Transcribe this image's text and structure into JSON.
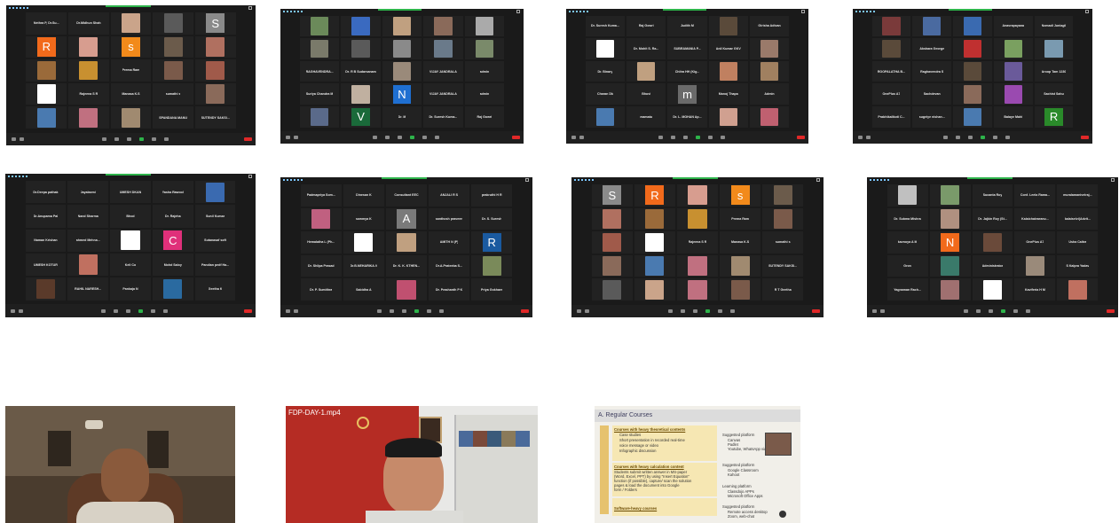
{
  "screens": [
    {
      "tiles": [
        {
          "name": "Nethra P, Dr.Su..."
        },
        {
          "name": "Dr.Midhun Shah"
        },
        {
          "photo": "#caa48a"
        },
        {
          "photo": "#5a5a5a"
        },
        {
          "letter": "S",
          "color": "#8a8a8a"
        },
        {
          "letter": "R",
          "color": "#f26a1b"
        },
        {
          "photo": "#d79d8f"
        },
        {
          "letter": "s",
          "color": "#f28a1b"
        },
        {
          "photo": "#6b5b4b"
        },
        {
          "photo": "#b07060"
        },
        {
          "photo": "#9a6a3a"
        },
        {
          "photo": "#c89030"
        },
        {
          "name": "Prema Ram"
        },
        {
          "photo": "#7a5a4a"
        },
        {
          "photo": "#a05a4a"
        },
        {
          "photo": "#ffffff"
        },
        {
          "name": "Rajeena S R"
        },
        {
          "name": "Manasa K.S"
        },
        {
          "name": "sumathi s"
        },
        {
          "photo": "#8a6a5a"
        },
        {
          "photo": "#4a7ab0"
        },
        {
          "photo": "#c07080"
        },
        {
          "photo": "#a08a70"
        },
        {
          "name": "SPANDANA MANU"
        },
        {
          "name": "SUTENDY SAKSI..."
        }
      ]
    },
    {
      "tiles": [
        {
          "photo": "#6b8a5a"
        },
        {
          "photo": "#3a6ac0"
        },
        {
          "photo": "#c0a080"
        },
        {
          "photo": "#8a6a5a"
        },
        {
          "photo": "#aaaaaa"
        },
        {
          "photo": "#7a7a6a"
        },
        {
          "photo": "#5a5a5a"
        },
        {
          "photo": "#8a8a8a"
        },
        {
          "photo": "#6a7a8a"
        },
        {
          "photo": "#7a8a6a"
        },
        {
          "name": "RAGHAVENDRA... "
        },
        {
          "name": "Dr. R B Sudarsanam"
        },
        {
          "photo": "#9a8a7a"
        },
        {
          "name": "VIJAY JANDRALA"
        },
        {
          "name": "admin"
        },
        {
          "name": "Suriya Chandra M"
        },
        {
          "photo": "#c0b0a0"
        },
        {
          "letter": "N",
          "color": "#1f6fd1"
        },
        {
          "name": "VIJAY JANDRALA"
        },
        {
          "name": "admin"
        },
        {
          "photo": "#5a6a8a"
        },
        {
          "letter": "V",
          "color": "#1a6a3a"
        },
        {
          "name": "Dr. M"
        },
        {
          "name": "Dr. Suresh Kuma..."
        },
        {
          "name": "Raj Gowri"
        }
      ]
    },
    {
      "tiles": [
        {
          "name": "Dr. Suresh Kuma..."
        },
        {
          "name": "Raj Gowri"
        },
        {
          "name": "Judith M"
        },
        {
          "photo": "#5a4a3a"
        },
        {
          "name": "Girisha Adivan"
        },
        {
          "photo": "#ffffff"
        },
        {
          "name": "Dr. Mohit S. Ra..."
        },
        {
          "name": "SUBRAMANIA P..."
        },
        {
          "name": "Anil Kumar GKV"
        },
        {
          "photo": "#9a7a6a"
        },
        {
          "name": "Dr. Binary"
        },
        {
          "photo": "#c0a080"
        },
        {
          "name": "Chitra HH (Kig..."
        },
        {
          "photo": "#c08060"
        },
        {
          "photo": "#a08060"
        },
        {
          "name": "Charan Dk"
        },
        {
          "name": "Bhuvi"
        },
        {
          "letter": "m",
          "color": "#6a6a6a"
        },
        {
          "name": "Manoj Thapa"
        },
        {
          "name": "Admin"
        },
        {
          "photo": "#4a7ab0"
        },
        {
          "name": "mamatu"
        },
        {
          "name": "Dr. L. MOHAN Ap..."
        },
        {
          "photo": "#d0a090"
        },
        {
          "photo": "#c06070"
        }
      ]
    },
    {
      "tiles": [
        {
          "photo": "#7a3a3a"
        },
        {
          "photo": "#4a6aa0"
        },
        {
          "photo": "#3a6ab0"
        },
        {
          "name": "Anavrapayana"
        },
        {
          "name": "Nomadi Juniagil"
        },
        {
          "photo": "#5a4a3a"
        },
        {
          "name": "Akshara George"
        },
        {
          "photo": "#c03030"
        },
        {
          "photo": "#7aa060"
        },
        {
          "photo": "#7a9ab0"
        },
        {
          "name": "ROOPALATHA B..."
        },
        {
          "name": "Raghavendra S"
        },
        {
          "photo": "#5a4a3a"
        },
        {
          "photo": "#6a5a9a"
        },
        {
          "name": "Aroop Tam 1230"
        },
        {
          "name": "OnePlus A7"
        },
        {
          "name": "Sachdevan"
        },
        {
          "photo": "#8a6a5a"
        },
        {
          "photo": "#9a4ab0"
        },
        {
          "name": "Sachist Sahu"
        },
        {
          "name": "Prabhikalikoti C..."
        },
        {
          "name": "sugeiye nishan..."
        },
        {
          "photo": "#4a7ab0"
        },
        {
          "name": "Balaye Mahi"
        },
        {
          "letter": "R",
          "color": "#2a8a2a"
        }
      ]
    },
    {
      "tiles": [
        {
          "name": "Dr.Deepa pathak"
        },
        {
          "name": "Jayalaxmi"
        },
        {
          "name": "UMESH DKAN"
        },
        {
          "name": "Yasha Rawool"
        },
        {
          "photo": "#3a6ab0"
        },
        {
          "name": "Dr.Anupama Pal"
        },
        {
          "name": "Nand Sharma"
        },
        {
          "name": "Bhod"
        },
        {
          "name": "Dr. Rajeha"
        },
        {
          "name": "Sunil Kumar"
        },
        {
          "name": "Naman Krishan"
        },
        {
          "name": "ahmed Mehna..."
        },
        {
          "photo": "#ffffff"
        },
        {
          "letter": "C",
          "color": "#e0307a"
        },
        {
          "name": "Sutanasaf soft"
        },
        {
          "name": "UMESH KOTUR"
        },
        {
          "photo": "#c07060"
        },
        {
          "name": "Keli Co"
        },
        {
          "name": "Mohd Saloy"
        },
        {
          "name": "Pandian pedf Ha..."
        },
        {
          "photo": "#5a3a2a"
        },
        {
          "name": "RAHIL NARESH..."
        },
        {
          "name": "Pankaja N"
        },
        {
          "photo": "#2a6aa0"
        },
        {
          "name": "Geetha K"
        }
      ]
    },
    {
      "tiles": [
        {
          "name": "Padmapriya Som..."
        },
        {
          "name": "Dinesan K"
        },
        {
          "name": "Consultant EEC"
        },
        {
          "name": "ANJALI R S"
        },
        {
          "name": "prakruthi H R"
        },
        {
          "photo": "#c06080"
        },
        {
          "name": "sowmya K"
        },
        {
          "letter": "A",
          "color": "#7a7a7a"
        },
        {
          "name": "santhosh praveen"
        },
        {
          "name": "Dr. S. Suresh"
        },
        {
          "name": "Hemalatha L (Ph..."
        },
        {
          "photo": "#ffffff"
        },
        {
          "photo": "#c0a080"
        },
        {
          "name": "AMITH N (P)"
        },
        {
          "letter": "R",
          "color": "#1a5aa0"
        },
        {
          "name": "Dr. Shilpa Prasad"
        },
        {
          "name": "Dr.B.NEHARIKA.V"
        },
        {
          "name": "Dr. K. K. KTHEN..."
        },
        {
          "name": "Dr.A.Prateeba S..."
        },
        {
          "photo": "#7a8a5a"
        },
        {
          "name": "Dr. P. Sumithra"
        },
        {
          "name": "Sabidha A"
        },
        {
          "photo": "#c05070"
        },
        {
          "name": "Dr. Prashanth P K"
        },
        {
          "name": "Priya Gokhare"
        }
      ]
    },
    {
      "tiles": [
        {
          "letter": "S",
          "color": "#8a8a8a"
        },
        {
          "letter": "R",
          "color": "#f26a1b"
        },
        {
          "photo": "#d79d8f"
        },
        {
          "letter": "s",
          "color": "#f28a1b"
        },
        {
          "photo": "#6b5b4b"
        },
        {
          "photo": "#b07060"
        },
        {
          "photo": "#9a6a3a"
        },
        {
          "photo": "#c89030"
        },
        {
          "name": "Prema Ram"
        },
        {
          "photo": "#7a5a4a"
        },
        {
          "photo": "#a05a4a"
        },
        {
          "photo": "#ffffff"
        },
        {
          "name": "Rajeena S R"
        },
        {
          "name": "Manasa K.S"
        },
        {
          "name": "sumathi s"
        },
        {
          "photo": "#8a6a5a"
        },
        {
          "photo": "#4a7ab0"
        },
        {
          "photo": "#c07080"
        },
        {
          "photo": "#a08a70"
        },
        {
          "name": "SUTENDY SAKSI..."
        },
        {
          "photo": "#5a5a5a"
        },
        {
          "photo": "#caa48a"
        },
        {
          "photo": "#c07080"
        },
        {
          "photo": "#7a5a4a"
        },
        {
          "name": "R T Geetha"
        }
      ]
    },
    {
      "tiles": [
        {
          "photo": "#c0c0c0"
        },
        {
          "photo": "#7a9a6a"
        },
        {
          "name": "Sucanta Roy"
        },
        {
          "name": "Conf. Leela Rama..."
        },
        {
          "name": "muralamanivelraj..."
        },
        {
          "name": "Dr. Subma Mishra"
        },
        {
          "photo": "#b09080"
        },
        {
          "name": "Dr. Jajkin Roy (St..."
        },
        {
          "name": "Kalaichaivaranu..."
        },
        {
          "name": "kalaiselvi(Advit..."
        },
        {
          "name": "kavnoya A M"
        },
        {
          "letter": "N",
          "color": "#f26a1b"
        },
        {
          "photo": "#6a4a3a"
        },
        {
          "name": "OnePlus A7"
        },
        {
          "name": "Usha Caltra"
        },
        {
          "name": "Gron"
        },
        {
          "photo": "#3a7a6a"
        },
        {
          "name": "Administrator"
        },
        {
          "photo": "#9a8a7a"
        },
        {
          "name": "S Kalpra Yadav"
        },
        {
          "name": "Yagnaman Rach..."
        },
        {
          "photo": "#a07070"
        },
        {
          "photo": "#ffffff"
        },
        {
          "name": "Kaviferia H M"
        },
        {
          "photo": "#c07060"
        }
      ]
    }
  ],
  "videos": {
    "v1": {
      "label": ""
    },
    "v2": {
      "label": "FDP-DAY-1.mp4"
    },
    "v3": {
      "title": "A.  Regular Courses",
      "box1_head": "Courses with heavy theoretical contents",
      "box1_items": [
        "Case studies",
        "Short presentation in recorded real-time",
        "voice message or video",
        "Infographic discussion"
      ],
      "box2_head": "Courses with heavy calculation content",
      "box2_items": [
        "Students submit written answer in MS-paper",
        "(Word, Excel, PPT) by using \"Insert Equation\"",
        "function (if possible), capture/ scan the solution",
        "pages & load the document into Google",
        "form / Folders"
      ],
      "box3_head": "Software-heavy courses",
      "right1_head": "Suggested platform",
      "right1_items": [
        "Canvas",
        "Padlet",
        "Youtube, WhatsApp video"
      ],
      "right2_head": "Suggested platform",
      "right2_items": [
        "Google Classroom",
        "Kahoot"
      ],
      "right3_head": "Learning platform",
      "right3_items": [
        "Classdojo APPs",
        "Microsoft Office Apps"
      ],
      "right4_head": "Suggested platform",
      "right4_items": [
        "Remote access desktop",
        "Zoom, web-chat"
      ]
    }
  }
}
